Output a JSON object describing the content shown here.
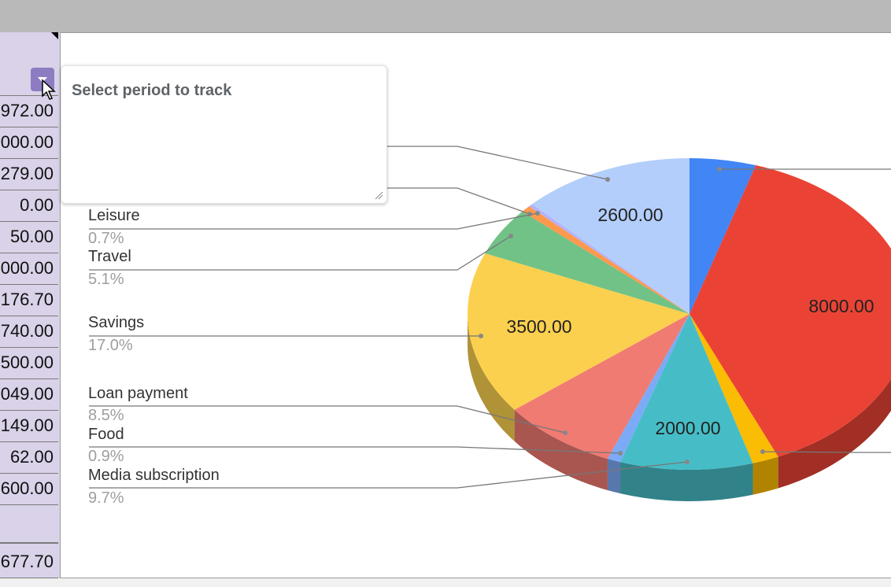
{
  "sheet": {
    "cells": [
      "972.00",
      "000.00",
      "279.00",
      "0.00",
      "50.00",
      "000.00",
      "176.70",
      "740.00",
      "500.00",
      "049.00",
      "149.00",
      "62.00",
      "600.00",
      "",
      "677.70"
    ]
  },
  "tooltip": {
    "text": "Select period to track"
  },
  "legend": [
    {
      "name": "Leisure",
      "pct": "0.7%"
    },
    {
      "name": "Travel",
      "pct": "5.1%"
    },
    {
      "name": "Savings",
      "pct": "17.0%"
    },
    {
      "name": "Loan payment",
      "pct": "8.5%"
    },
    {
      "name": "Food",
      "pct": "0.9%"
    },
    {
      "name": "Media subscription",
      "pct": "9.7%"
    }
  ],
  "chart_data": {
    "type": "pie",
    "values": [
      1000,
      8000,
      400,
      2000,
      200,
      1749,
      3500,
      1049,
      149,
      62,
      2600
    ],
    "slice_colors": [
      "#4285f4",
      "#ea4335",
      "#fbbc04",
      "#46bdc6",
      "#7baaf7",
      "#f07b72",
      "#fcd04f",
      "#71c287",
      "#ff994d",
      "#b3b3ff",
      "#b3cefb"
    ],
    "side_colors": [
      "#2e5eaa",
      "#a12f25",
      "#b08400",
      "#318389",
      "#5777ad",
      "#a8564f",
      "#b09237",
      "#4f885e",
      "#b26b36",
      "#7d7db3",
      "#7d90b0"
    ],
    "data_labels": [
      {
        "slice": 1,
        "text": "8000.00"
      },
      {
        "slice": 3,
        "text": "2000.00"
      },
      {
        "slice": 6,
        "text": "3500.00"
      },
      {
        "slice": 10,
        "text": "2600.00"
      }
    ]
  }
}
